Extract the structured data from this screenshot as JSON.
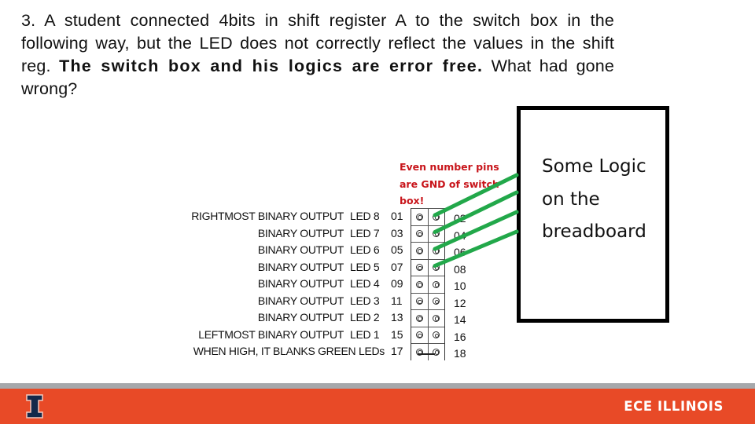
{
  "question": {
    "prefix": "3. A student connected 4bits in shift register A to the switch box in the following way, but the LED does not correctly reflect the values in the shift reg.",
    "bold": "The switch box and his logics are error free.",
    "suffix": "What had gone wrong?"
  },
  "annotation": {
    "note": "Even number pins are GND of switch box!",
    "color": "#c8151b"
  },
  "switch_box": {
    "rows": [
      {
        "label": "RIGHTMOST BINARY OUTPUT",
        "led": "LED 8",
        "odd": "01",
        "even": "02"
      },
      {
        "label": "BINARY OUTPUT",
        "led": "LED 7",
        "odd": "03",
        "even": "04"
      },
      {
        "label": "BINARY OUTPUT",
        "led": "LED 6",
        "odd": "05",
        "even": "06"
      },
      {
        "label": "BINARY OUTPUT",
        "led": "LED 5",
        "odd": "07",
        "even": "08"
      },
      {
        "label": "BINARY OUTPUT",
        "led": "LED 4",
        "odd": "09",
        "even": "10"
      },
      {
        "label": "BINARY OUTPUT",
        "led": "LED 3",
        "odd": "11",
        "even": "12"
      },
      {
        "label": "BINARY OUTPUT",
        "led": "LED 2",
        "odd": "13",
        "even": "14"
      },
      {
        "label": "LEFTMOST BINARY OUTPUT",
        "led": "LED 1",
        "odd": "15",
        "even": "16"
      },
      {
        "label": "WHEN HIGH, IT BLANKS GREEN LEDs",
        "led": "",
        "odd": "17",
        "even": "18"
      }
    ],
    "wired_even_pins": [
      "02",
      "04",
      "06",
      "08"
    ],
    "wire_color": "#22a84a"
  },
  "logic_box": {
    "lines": [
      "Some Logic",
      "on the",
      "breadboard"
    ]
  },
  "footer": {
    "brand": "ECE ILLINOIS",
    "logo": "block-i-logo-icon",
    "accent_color": "#e84a27",
    "stripe_color": "#a6a8ab",
    "logo_color": "#13294b"
  }
}
